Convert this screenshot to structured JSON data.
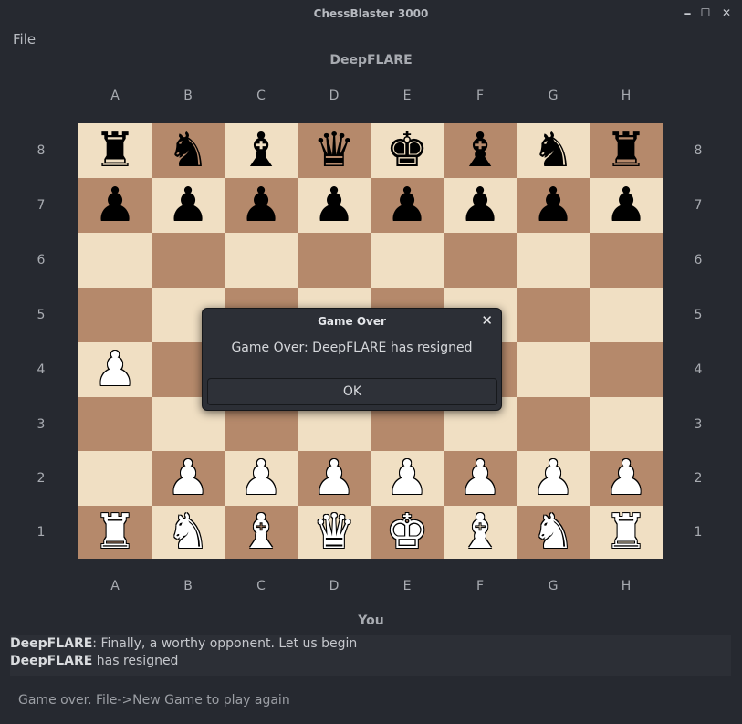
{
  "window": {
    "title": "ChessBlaster 3000",
    "minimize_glyph": "🗕",
    "maximize_glyph": "☐",
    "close_glyph": "✕"
  },
  "menu": {
    "file": "File"
  },
  "players": {
    "top": "DeepFLARE",
    "bottom": "You"
  },
  "files": [
    "A",
    "B",
    "C",
    "D",
    "E",
    "F",
    "G",
    "H"
  ],
  "ranks": [
    "8",
    "7",
    "6",
    "5",
    "4",
    "3",
    "2",
    "1"
  ],
  "board": [
    [
      "bR",
      "bN",
      "bB",
      "bQ",
      "bK",
      "bB",
      "bN",
      "bR"
    ],
    [
      "bP",
      "bP",
      "bP",
      "bP",
      "bP",
      "bP",
      "bP",
      "bP"
    ],
    [
      "",
      "",
      "",
      "",
      "",
      "",
      "",
      ""
    ],
    [
      "",
      "",
      "",
      "",
      "",
      "",
      "",
      ""
    ],
    [
      "wP",
      "",
      "",
      "",
      "",
      "",
      "",
      ""
    ],
    [
      "",
      "",
      "",
      "",
      "",
      "",
      "",
      ""
    ],
    [
      "",
      "wP",
      "wP",
      "wP",
      "wP",
      "wP",
      "wP",
      "wP"
    ],
    [
      "wR",
      "wN",
      "wB",
      "wQ",
      "wK",
      "wB",
      "wN",
      "wR"
    ]
  ],
  "dialog": {
    "title": "Game Over",
    "close_glyph": "✕",
    "message": "Game Over: DeepFLARE has resigned",
    "ok_label": "OK"
  },
  "chat_log": [
    {
      "speaker": "DeepFLARE",
      "text": ": Finally, a worthy opponent. Let us begin"
    },
    {
      "speaker": "DeepFLARE",
      "text": " has resigned"
    }
  ],
  "status": "Game over. File->New Game to play again"
}
